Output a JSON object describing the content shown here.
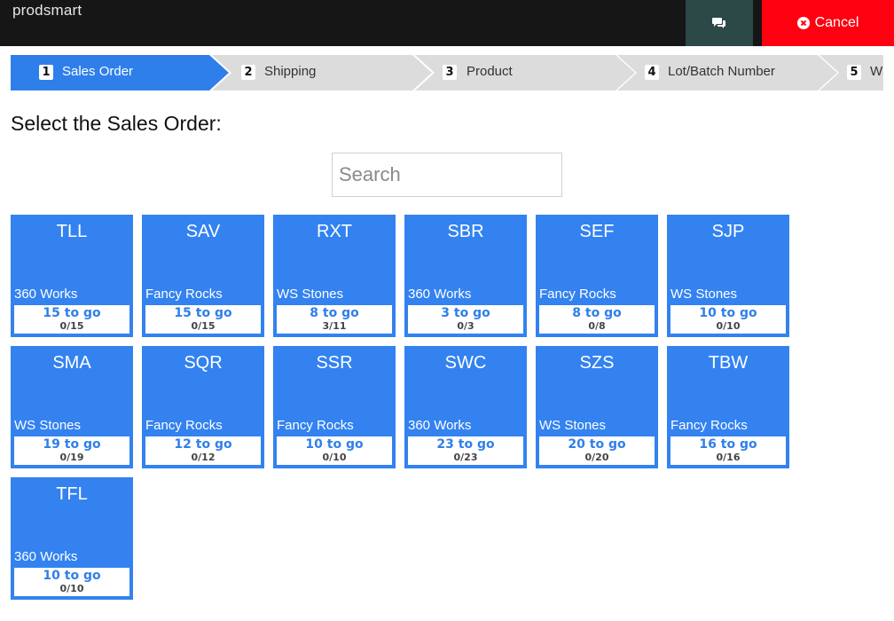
{
  "app": {
    "logo": "prodsmart"
  },
  "header": {
    "chat_icon": "comments-icon",
    "cancel_label": "Cancel",
    "cancel_icon": "times-circle-icon",
    "cancel_color": "#ff0011",
    "chat_bg": "#2c4847"
  },
  "steps": [
    {
      "num": "1",
      "label": "Sales Order",
      "active": true
    },
    {
      "num": "2",
      "label": "Shipping",
      "active": false
    },
    {
      "num": "3",
      "label": "Product",
      "active": false
    },
    {
      "num": "4",
      "label": "Lot/Batch Number",
      "active": false
    },
    {
      "num": "5",
      "label": "W",
      "active": false
    }
  ],
  "main": {
    "heading": "Select the Sales Order:",
    "search_placeholder": "Search",
    "search_value": ""
  },
  "colors": {
    "accent": "#2f7fea",
    "tile": "#3382f0"
  },
  "orders": [
    {
      "code": "TLL",
      "customer": "360 Works",
      "togo": "15 to go",
      "progress": "0/15"
    },
    {
      "code": "SAV",
      "customer": "Fancy Rocks",
      "togo": "15 to go",
      "progress": "0/15"
    },
    {
      "code": "RXT",
      "customer": "WS Stones",
      "togo": "8 to go",
      "progress": "3/11"
    },
    {
      "code": "SBR",
      "customer": "360 Works",
      "togo": "3 to go",
      "progress": "0/3"
    },
    {
      "code": "SEF",
      "customer": "Fancy Rocks",
      "togo": "8 to go",
      "progress": "0/8"
    },
    {
      "code": "SJP",
      "customer": "WS Stones",
      "togo": "10 to go",
      "progress": "0/10"
    },
    {
      "code": "SMA",
      "customer": "WS Stones",
      "togo": "19 to go",
      "progress": "0/19"
    },
    {
      "code": "SQR",
      "customer": "Fancy Rocks",
      "togo": "12 to go",
      "progress": "0/12"
    },
    {
      "code": "SSR",
      "customer": "Fancy Rocks",
      "togo": "10 to go",
      "progress": "0/10"
    },
    {
      "code": "SWC",
      "customer": "360 Works",
      "togo": "23 to go",
      "progress": "0/23"
    },
    {
      "code": "SZS",
      "customer": "WS Stones",
      "togo": "20 to go",
      "progress": "0/20"
    },
    {
      "code": "TBW",
      "customer": "Fancy Rocks",
      "togo": "16 to go",
      "progress": "0/16"
    },
    {
      "code": "TFL",
      "customer": "360 Works",
      "togo": "10 to go",
      "progress": "0/10"
    }
  ]
}
